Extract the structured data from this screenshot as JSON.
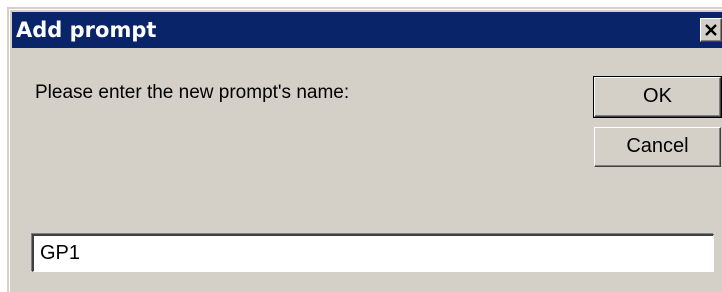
{
  "dialog": {
    "title": "Add prompt",
    "close_icon": "close-icon",
    "prompt_label": "Please enter the new prompt's name:",
    "ok_label": "OK",
    "cancel_label": "Cancel",
    "name_value": "GP1",
    "title_color": "#0a246a",
    "face_color": "#d4d0c8"
  }
}
